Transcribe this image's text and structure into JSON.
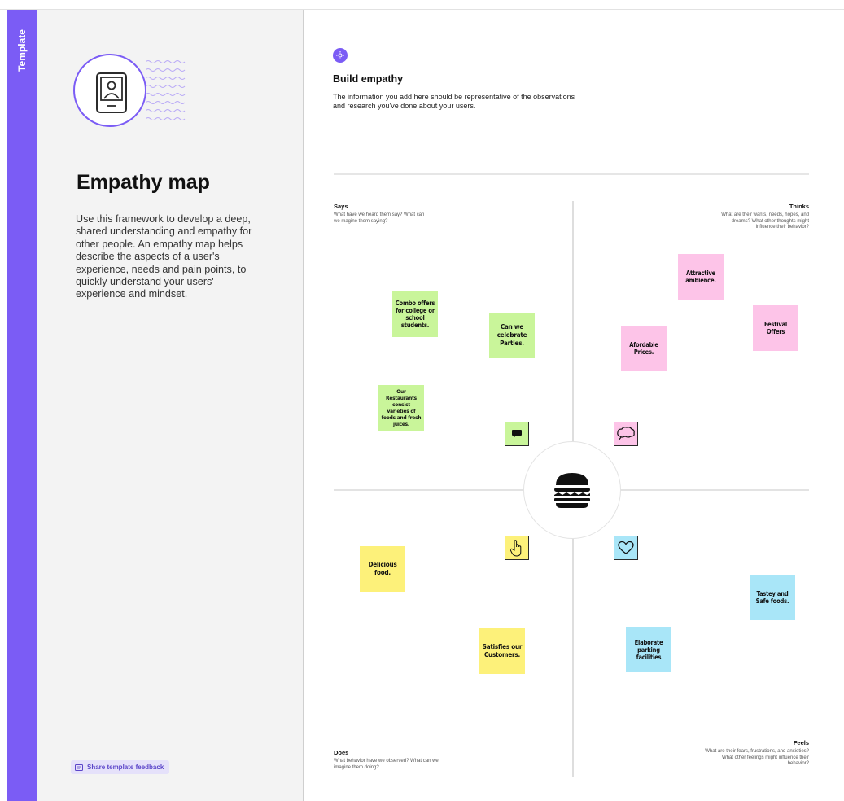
{
  "sidebar": {
    "tag_label": "Template"
  },
  "panel": {
    "title": "Empathy map",
    "description": "Use this framework to develop a deep, shared understanding and empathy for other people. An empathy map helps describe the aspects of a user's experience, needs and pain points, to quickly understand your users' experience and mindset.",
    "feedback_label": "Share template feedback"
  },
  "canvas": {
    "heading": "Build empathy",
    "subheading": "The information you add here should be representative of the observations and research you've done about your users.",
    "quadrants": {
      "says": {
        "title": "Says",
        "desc": "What have we heard them say? What can we magine them saying?"
      },
      "thinks": {
        "title": "Thinks",
        "desc": "What are their wants, needs, hopes, and dreams? What other thoughts might influence their behavior?"
      },
      "does": {
        "title": "Does",
        "desc": "What behavior have we observed? What can we imagine them doing?"
      },
      "feels": {
        "title": "Feels",
        "desc": "What are their fears, frustrations, and anxieties? What other feelings might influence their behavior?"
      }
    },
    "stickies": {
      "combo": "Combo offers for college or school students.",
      "celebrate": "Can we celebrate Parties.",
      "varieties": "Our Restaurants consist varieties of foods and fresh juices.",
      "ambience": "Attractive ambience.",
      "festival": "Festival Offers",
      "affordable": "Afordable Prices.",
      "delicious": "Delicious food.",
      "satisfies": "Satisfies our Customers.",
      "tastey": "Tastey and Safe foods.",
      "parking": "Elaborate parking facilities"
    }
  },
  "colors": {
    "accent": "#7b5cf5",
    "says": "#c9f59a",
    "thinks": "#fdc4e8",
    "does": "#fdf17a",
    "feels": "#a9e6f8"
  },
  "icons": {
    "hero": "tablet-person-icon",
    "center": "burger-icon",
    "says": "speech-bubble-icon",
    "thinks": "thought-bubble-icon",
    "does": "pointing-hand-icon",
    "feels": "heart-icon",
    "build": "sparkle-icon",
    "feedback": "message-icon"
  }
}
